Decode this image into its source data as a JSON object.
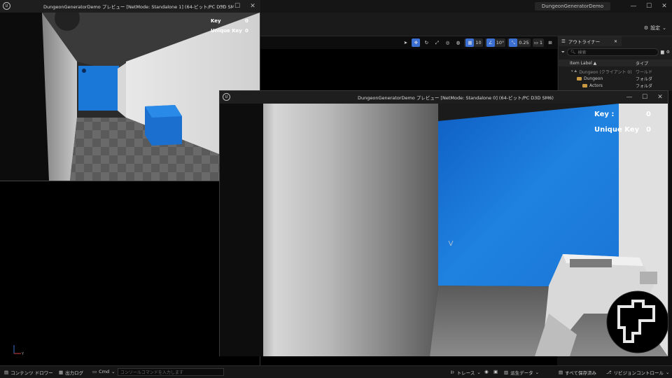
{
  "editor": {
    "project_title": "DungeonGeneratorDemo",
    "settings_label": "設定"
  },
  "window_controls": {
    "minimize": "—",
    "maximize": "☐",
    "close": "✕"
  },
  "viewport_toolbar": {
    "grid_snap": "10",
    "rotation_snap": "10°",
    "scale_snap": "0.25",
    "camera_speed": "1"
  },
  "outliner": {
    "tab_label": "アウトライナー",
    "search_placeholder": "検索",
    "columns": {
      "label": "Item Label ▲",
      "type": "タイプ"
    },
    "rows": [
      {
        "label": "Dungeon (クライアント 0)",
        "type": "ワールド"
      },
      {
        "label": "Dungeon",
        "type": "フォルダ"
      },
      {
        "label": "Actors",
        "type": "フォルダ"
      }
    ]
  },
  "preview_1": {
    "title": "DungeonGeneratorDemo プレビュー [NetMode: Standalone 1]  (64-ビット/PC D3D SM",
    "hud": {
      "key_label": "Key",
      "key_value": "0",
      "unique_label": "Unique Key",
      "unique_value": "0"
    }
  },
  "preview_2": {
    "title": "DungeonGeneratorDemo プレビュー [NetMode: Standalone 0]  (64-ビット/PC D3D SM6)",
    "hud": {
      "key_label": "Key :",
      "key_value": "0",
      "unique_label": "Unique Key",
      "unique_value": "0"
    }
  },
  "statusbar": {
    "content_drawer": "コンテンツ ドロワー",
    "output_log": "出力ログ",
    "cmd": "Cmd",
    "console_placeholder": "コンソールコマンドを入力します",
    "trace": "トレース",
    "derived_data": "派生データ",
    "save_all": "すべて保存済み",
    "revision_control": "リビジョンコントロール"
  },
  "colors": {
    "accent": "#3b6fd1",
    "wall_blue": "#1a78d8",
    "folder": "#c99a42"
  }
}
